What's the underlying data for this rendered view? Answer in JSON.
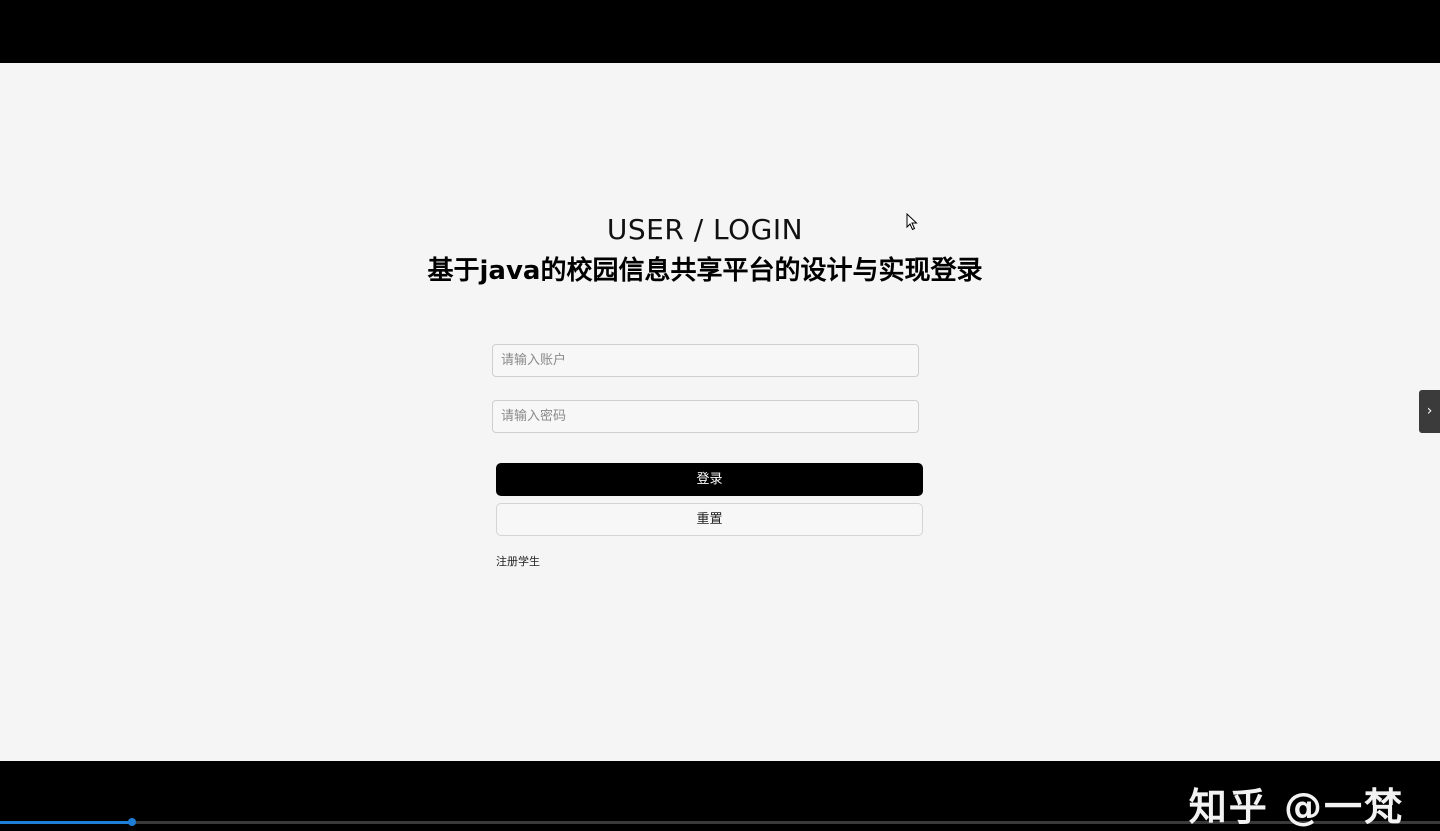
{
  "login": {
    "heading": "USER / LOGIN",
    "app_title": "基于java的校园信息共享平台的设计与实现登录",
    "account_placeholder": "请输入账户",
    "password_placeholder": "请输入密码",
    "login_button": "登录",
    "reset_button": "重置",
    "register_link": "注册学生"
  },
  "side_panel": {
    "toggle_icon": "chevron-right-icon",
    "toggle_glyph": "›"
  },
  "watermark": {
    "text": "知乎 @一梵"
  },
  "video_progress": {
    "fraction": 0.092
  },
  "colors": {
    "page_background": "#f5f5f5",
    "primary_button": "#000000",
    "progress_accent": "#1e7ed6"
  }
}
